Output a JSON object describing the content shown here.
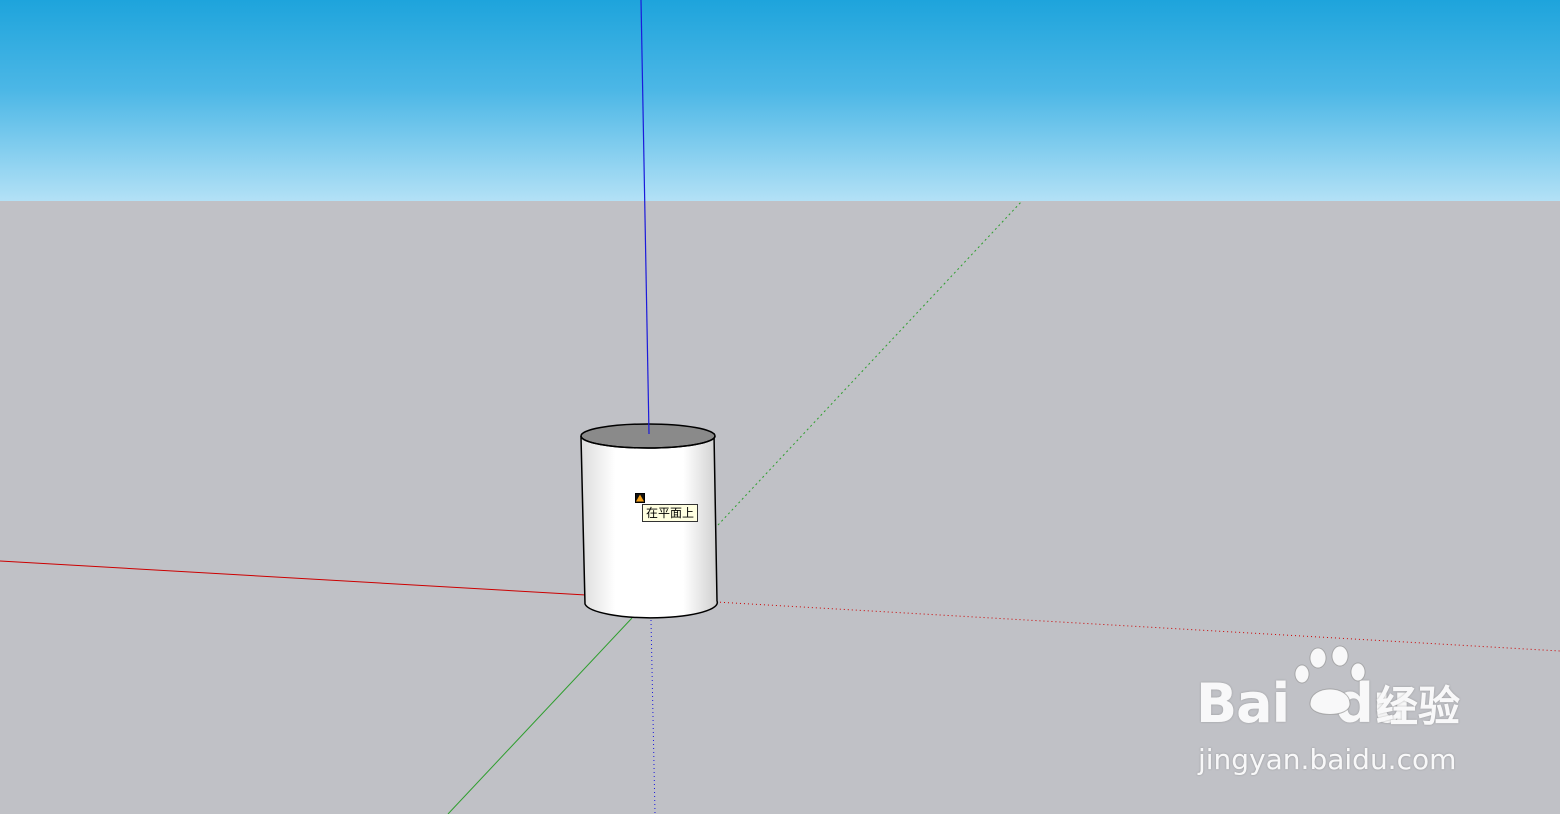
{
  "viewport": {
    "sky_top_color": "#1ea4dc",
    "sky_bottom_color": "#b3e1f6",
    "ground_color": "#c0c1c6"
  },
  "axes": {
    "red_axis_color": "#cc0000",
    "green_axis_color": "#2e9e2e",
    "blue_axis_color": "#1a1adb"
  },
  "cylinder": {
    "body_color": "#ffffff",
    "top_face_color": "#8a8a8a",
    "edge_color": "#000000"
  },
  "inference": {
    "tooltip_text": "在平面上",
    "marker_icon": "on-face-inference-icon"
  },
  "watermark": {
    "brand": "Bai",
    "brand_du": "du",
    "brand_suffix": "经验",
    "url": "jingyan.baidu.com"
  }
}
